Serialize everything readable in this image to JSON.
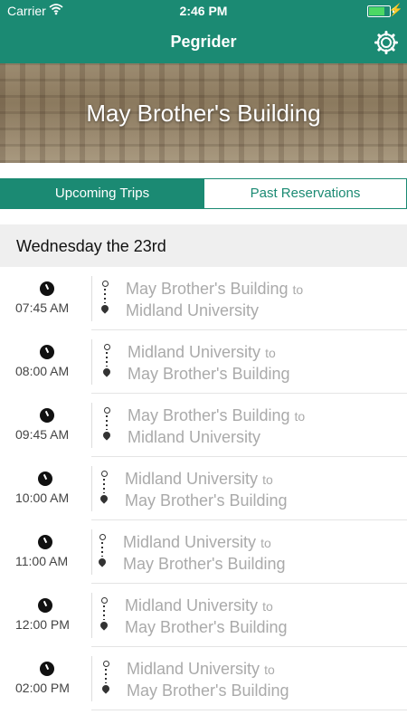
{
  "status": {
    "carrier": "Carrier",
    "time": "2:46 PM",
    "battery_level": 0.85
  },
  "nav": {
    "title": "Pegrider",
    "settings_icon": "gear-icon"
  },
  "hero": {
    "title": "May Brother's Building"
  },
  "tabs": [
    {
      "label": "Upcoming Trips",
      "active": true
    },
    {
      "label": "Past Reservations",
      "active": false
    }
  ],
  "day": {
    "label": "Wednesday the 23rd"
  },
  "connector": "to",
  "trips": [
    {
      "time": "07:45 AM",
      "from": "May Brother's Building",
      "to": "Midland University"
    },
    {
      "time": "08:00 AM",
      "from": "Midland University",
      "to": "May Brother's Building"
    },
    {
      "time": "09:45 AM",
      "from": "May Brother's Building",
      "to": "Midland University"
    },
    {
      "time": "10:00 AM",
      "from": "Midland University",
      "to": "May Brother's Building"
    },
    {
      "time": "11:00 AM",
      "from": "Midland University",
      "to": "May Brother's Building"
    },
    {
      "time": "12:00 PM",
      "from": "Midland University",
      "to": "May Brother's Building"
    },
    {
      "time": "02:00 PM",
      "from": "Midland University",
      "to": "May Brother's Building"
    }
  ],
  "colors": {
    "brand": "#1b8a73",
    "battery": "#4cd964",
    "route_text": "#aaaaaa"
  }
}
